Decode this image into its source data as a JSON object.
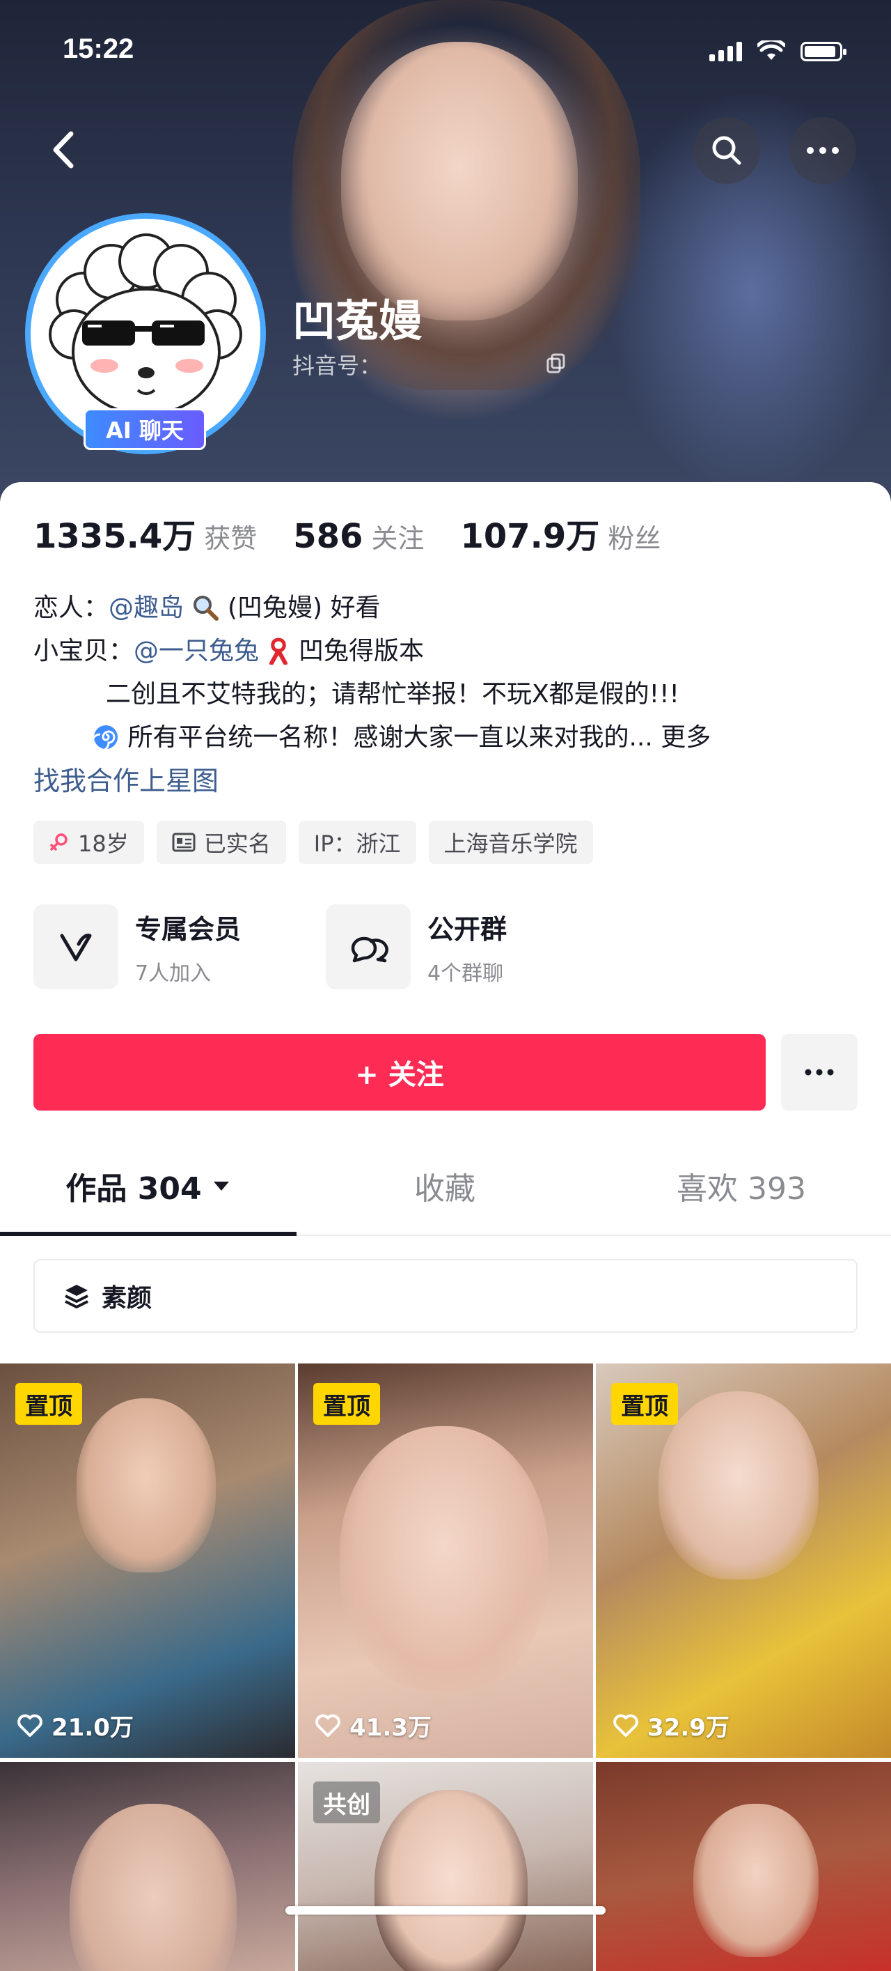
{
  "status_bar": {
    "time": "15:22"
  },
  "profile": {
    "nickname": "凹菟嫚",
    "douyin_id_label": "抖音号：",
    "ai_badge": "AI 聊天"
  },
  "stats": [
    {
      "value": "1335.4万",
      "label": "获赞"
    },
    {
      "value": "586",
      "label": "关注"
    },
    {
      "value": "107.9万",
      "label": "粉丝"
    }
  ],
  "bio": {
    "lover_prefix": "恋人：",
    "lover_mention": "@趣岛",
    "lover_suffix": "(凹兔嫚) 好看",
    "baby_prefix": "小宝贝：",
    "baby_mention": "@一只兔兔",
    "baby_suffix": "凹兔得版本",
    "line3": "二创且不艾特我的；请帮忙举报！不玩X都是假的!!!",
    "line4": "所有平台统一名称！感谢大家一直以来对我的...",
    "more": "更多",
    "star_link": "找我合作上星图"
  },
  "tags": [
    "18岁",
    "已实名",
    "IP：浙江",
    "上海音乐学院"
  ],
  "features": [
    {
      "title": "专属会员",
      "subtitle": "7人加入"
    },
    {
      "title": "公开群",
      "subtitle": "4个群聊"
    }
  ],
  "follow_button": "+ 关注",
  "tabs": [
    {
      "label": "作品 304"
    },
    {
      "label": "收藏"
    },
    {
      "label": "喜欢 393"
    }
  ],
  "collection_label": "素颜",
  "videos": [
    {
      "badge": "置顶",
      "likes": "21.0万"
    },
    {
      "badge": "置顶",
      "likes": "41.3万"
    },
    {
      "badge": "置顶",
      "likes": "32.9万"
    },
    {
      "badge": "",
      "likes": ""
    },
    {
      "badge": "共创",
      "likes": ""
    },
    {
      "badge": "",
      "likes": ""
    }
  ],
  "colors": {
    "accent": "#fe2c55",
    "link": "#3d5d8f",
    "pin_badge": "#ffd600",
    "ai_badge": "#3d8cff"
  },
  "icons": [
    "back-icon",
    "search-icon",
    "more-icon",
    "copy-icon",
    "heart-icon",
    "layers-icon",
    "dropdown-icon"
  ]
}
